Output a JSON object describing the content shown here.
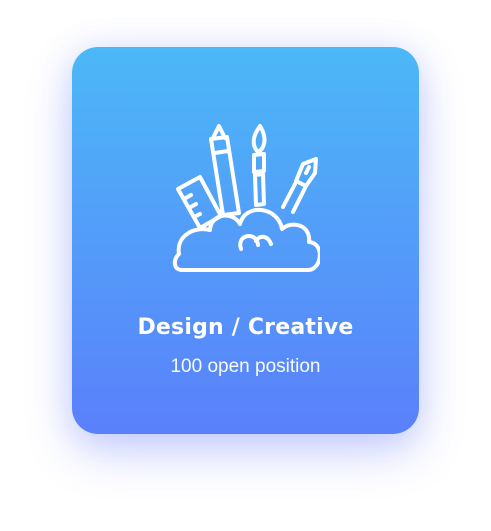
{
  "card": {
    "icon": "design-tools-cloud-icon",
    "title": "Design / Creative",
    "subtitle": "100 open position",
    "gradient_top": "#4cb8f7",
    "gradient_bottom": "#5a80fb",
    "text_color": "#ffffff"
  }
}
